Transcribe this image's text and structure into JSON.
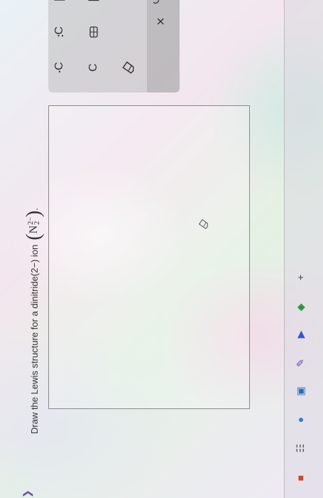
{
  "question": {
    "prefix": "Draw the Lewis structure for a dinitride(2−) ion",
    "formula_element": "N",
    "formula_charge": "2−",
    "formula_subscript": "2",
    "suffix": "."
  },
  "tools": {
    "carbon_label": "C",
    "radical_carbon_label": "C",
    "lonepair_carbon_label": "C",
    "close_label": "×"
  },
  "taskbar": {
    "plus_label": "+"
  },
  "colors": {
    "toolbox_bg": "#b4b4b4",
    "canvas_border": "#8a8a8a",
    "accent_purple": "#6a4fb0"
  }
}
